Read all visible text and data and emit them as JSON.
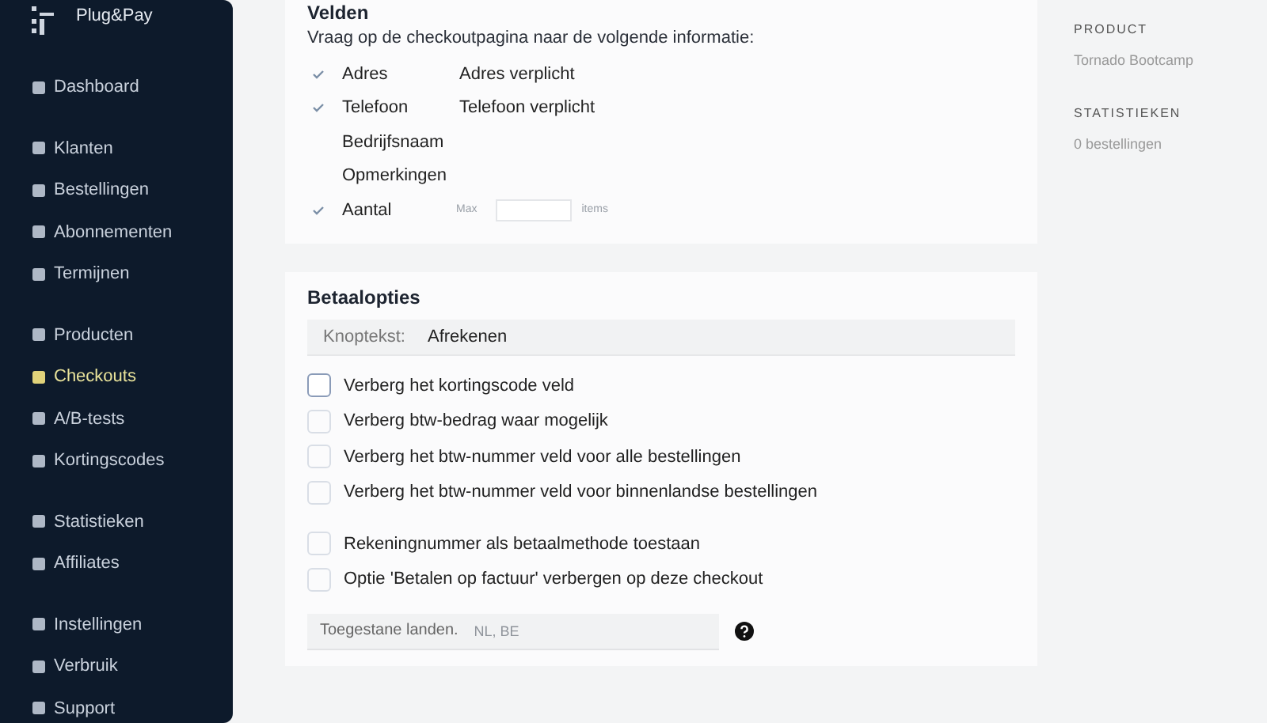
{
  "brand": {
    "name": "Plug&Pay"
  },
  "sidebar": {
    "groups": [
      [
        {
          "label": "Dashboard",
          "selected": false
        }
      ],
      [
        {
          "label": "Klanten",
          "selected": false
        },
        {
          "label": "Bestellingen",
          "selected": false
        },
        {
          "label": "Abonnementen",
          "selected": false
        },
        {
          "label": "Termijnen",
          "selected": false
        }
      ],
      [
        {
          "label": "Producten",
          "selected": false
        },
        {
          "label": "Checkouts",
          "selected": true
        },
        {
          "label": "A/B-tests",
          "selected": false
        },
        {
          "label": "Kortingscodes",
          "selected": false
        }
      ],
      [
        {
          "label": "Statistieken",
          "selected": false
        },
        {
          "label": "Affiliates",
          "selected": false
        }
      ],
      [
        {
          "label": "Instellingen",
          "selected": false
        },
        {
          "label": "Verbruik",
          "selected": false
        },
        {
          "label": "Support",
          "selected": false
        }
      ]
    ]
  },
  "fields": {
    "title": "Velden",
    "intro": "Vraag op de checkoutpagina naar de volgende informatie:",
    "items": [
      {
        "kind": "required",
        "label": "Adres",
        "checked": true,
        "extra": "Adres verplicht"
      },
      {
        "kind": "required",
        "label": "Telefoon",
        "checked": true,
        "extra": "Telefoon verplicht"
      },
      {
        "kind": "plain",
        "label": "Bedrijfsnaam",
        "checked": false
      },
      {
        "kind": "plain",
        "label": "Opmerkingen",
        "checked": false
      },
      {
        "kind": "quantity",
        "label": "Aantal",
        "checked": true,
        "prefix": "Max",
        "suffix": "items"
      }
    ]
  },
  "payment": {
    "title": "Betaalopties",
    "button_text": {
      "label": "Knoptekst:",
      "value": "Afrekenen"
    },
    "option_groups": [
      [
        {
          "label": "Verberg het kortingscode veld",
          "checked": false
        },
        {
          "label": "Verberg btw-bedrag waar mogelijk",
          "checked": false
        },
        {
          "label": "Verberg het btw-nummer veld voor alle bestellingen",
          "checked": false
        },
        {
          "label": "Verberg het btw-nummer veld voor binnenlandse bestellingen",
          "checked": false
        }
      ],
      [
        {
          "label": "Rekeningnummer als betaalmethode toestaan",
          "checked": false
        },
        {
          "label": "Optie 'Betalen op factuur' verbergen op deze checkout",
          "checked": false
        }
      ]
    ],
    "countries": {
      "label": "Toegestane landen.",
      "placeholder": "NL, BE"
    }
  },
  "aside": [
    {
      "heading": "PRODUCT",
      "value": "Tornado Bootcamp"
    },
    {
      "heading": "STATISTIEKEN",
      "value": "0 bestellingen"
    }
  ]
}
